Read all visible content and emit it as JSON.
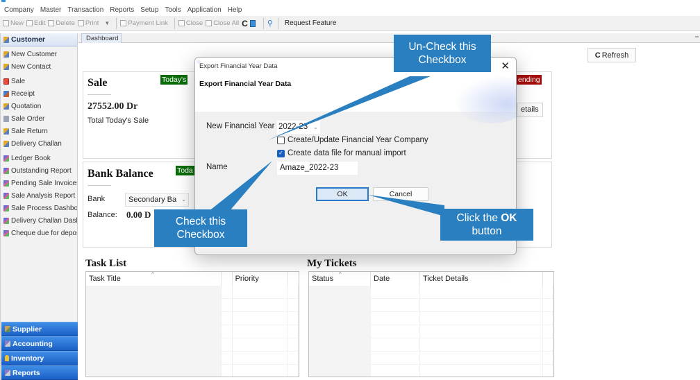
{
  "menubar": {
    "items": [
      "Company",
      "Master",
      "Transaction",
      "Reports",
      "Setup",
      "Tools",
      "Application",
      "Help"
    ]
  },
  "toolbar": {
    "new": "New",
    "edit": "Edit",
    "delete": "Delete",
    "print": "Print",
    "payment_link": "Payment Link",
    "close": "Close",
    "close_all": "Close All",
    "request_feature": "Request Feature"
  },
  "sidebar": {
    "header": "Customer",
    "items": [
      {
        "label": "New Customer",
        "icon": "person-icon"
      },
      {
        "label": "New Contact",
        "icon": "person-icon"
      },
      {
        "label": "Sale",
        "icon": "sale-icon"
      },
      {
        "label": "Receipt",
        "icon": "receipt-icon"
      },
      {
        "label": "Quotation",
        "icon": "person-icon"
      },
      {
        "label": "Sale Order",
        "icon": "order-icon"
      },
      {
        "label": "Sale Return",
        "icon": "person-icon"
      },
      {
        "label": "Delivery Challan",
        "icon": "person-icon"
      },
      {
        "label": "Ledger Book",
        "icon": "report-icon"
      },
      {
        "label": "Outstanding Report",
        "icon": "report-icon"
      },
      {
        "label": "Pending Sale Invoices",
        "icon": "report-icon"
      },
      {
        "label": "Sale Analysis Report",
        "icon": "report-icon"
      },
      {
        "label": "Sale Process Dashboa",
        "icon": "report-icon"
      },
      {
        "label": "Delivery Challan Dashl",
        "icon": "report-icon"
      },
      {
        "label": "Cheque due for depos",
        "icon": "report-icon"
      }
    ],
    "modules": [
      "Supplier",
      "Accounting",
      "Inventory",
      "Reports"
    ]
  },
  "tabs": {
    "dashboard": "Dashboard"
  },
  "dashboard": {
    "refresh_label": "Refresh",
    "sale_card": {
      "title": "Sale",
      "badge": "Today's",
      "amount": "27552.00 Dr",
      "subtitle": "Total Today's Sale"
    },
    "pending_card": {
      "badge": "ending",
      "details_button": "etails"
    },
    "bank_card": {
      "title": "Bank Balance",
      "badge": "Toda",
      "bank_label": "Bank",
      "bank_selected": "Secondary Ba",
      "balance_label": "Balance:",
      "balance_value": "0.00 D"
    },
    "task_list": {
      "title": "Task List",
      "columns": [
        "Task Title",
        "",
        "Priority",
        ""
      ]
    },
    "my_tickets": {
      "title": "My Tickets",
      "columns": [
        "Status",
        "Date",
        "Ticket Details",
        ""
      ]
    }
  },
  "dialog": {
    "window_title": "Export Financial Year Data",
    "header": "Export Financial Year Data",
    "close_glyph": "✕",
    "new_fy_label": "New Financial Year",
    "new_fy_value": "2022-23",
    "checkbox_create_update": {
      "label": "Create/Update Financial Year Company",
      "checked": false
    },
    "checkbox_data_file": {
      "label": "Create data file for manual import",
      "checked": true
    },
    "name_label": "Name",
    "name_value": "Amaze_2022-23",
    "ok_label": "OK",
    "cancel_label": "Cancel"
  },
  "callouts": {
    "uncheck": "Un-Check this Checkbox",
    "check": "Check this Checkbox",
    "click_ok_prefix": "Click the ",
    "click_ok_bold": "OK",
    "click_ok_suffix": "button"
  },
  "colors": {
    "callout_blue": "#2a7fc0",
    "badge_green": "#0a6b0a",
    "badge_red": "#a50d0d",
    "module_blue": "#1b5fc4"
  }
}
